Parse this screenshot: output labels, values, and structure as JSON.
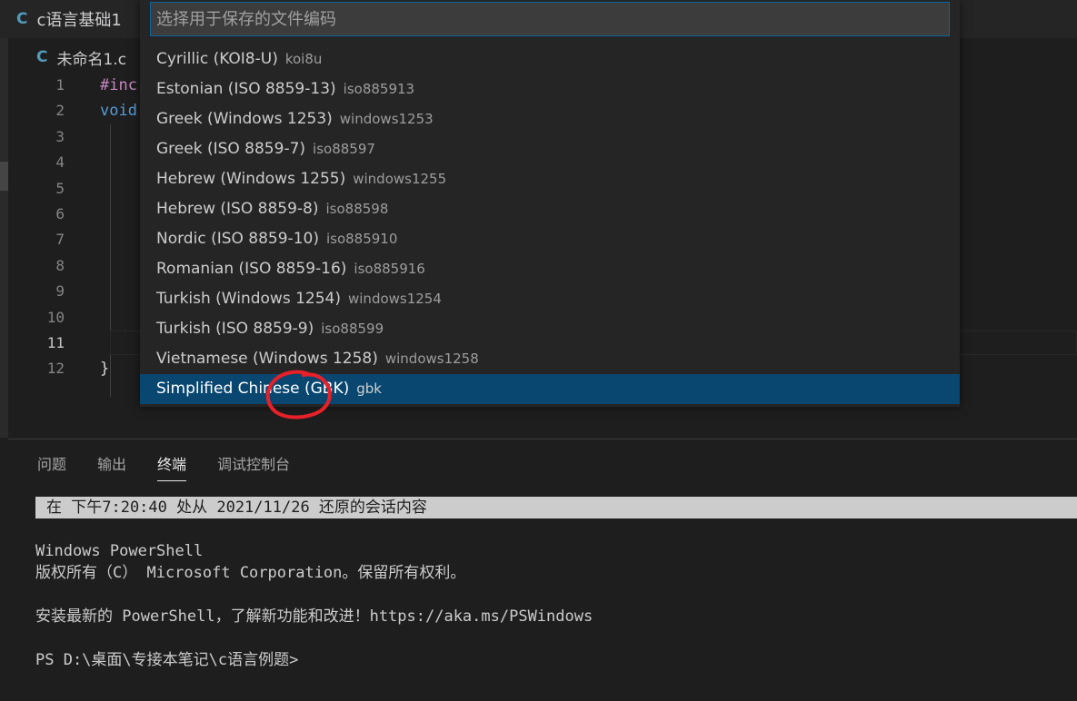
{
  "tab": {
    "label": "c语言基础1"
  },
  "breadcrumb": {
    "file": "未命名1.c"
  },
  "editor": {
    "line_numbers": [
      "1",
      "2",
      "3",
      "4",
      "5",
      "6",
      "7",
      "8",
      "9",
      "10",
      "11",
      "12"
    ],
    "active_line": "11",
    "code": {
      "line1": "#inc",
      "line2": "void",
      "line12": "}"
    }
  },
  "quickpick": {
    "placeholder": "选择用于保存的文件编码",
    "items": [
      {
        "label": "Cyrillic (KOI8-U)",
        "desc": "koi8u"
      },
      {
        "label": "Estonian (ISO 8859-13)",
        "desc": "iso885913"
      },
      {
        "label": "Greek (Windows 1253)",
        "desc": "windows1253"
      },
      {
        "label": "Greek (ISO 8859-7)",
        "desc": "iso88597"
      },
      {
        "label": "Hebrew (Windows 1255)",
        "desc": "windows1255"
      },
      {
        "label": "Hebrew (ISO 8859-8)",
        "desc": "iso88598"
      },
      {
        "label": "Nordic (ISO 8859-10)",
        "desc": "iso885910"
      },
      {
        "label": "Romanian (ISO 8859-16)",
        "desc": "iso885916"
      },
      {
        "label": "Turkish (Windows 1254)",
        "desc": "windows1254"
      },
      {
        "label": "Turkish (ISO 8859-9)",
        "desc": "iso88599"
      },
      {
        "label": "Vietnamese (Windows 1258)",
        "desc": "windows1258"
      },
      {
        "label": "Simplified Chinese (GBK)",
        "desc": "gbk"
      }
    ]
  },
  "panel": {
    "tabs": [
      "问题",
      "输出",
      "终端",
      "调试控制台"
    ],
    "active_tab": "终端"
  },
  "terminal": {
    "banner": "在 下午7:20:40 处从 2021/11/26 还原的会话内容",
    "line1": "Windows PowerShell",
    "line2": "版权所有（C） Microsoft Corporation。保留所有权利。",
    "line3": "安装最新的 PowerShell，了解新功能和改进！https://aka.ms/PSWindows",
    "line4": "PS D:\\桌面\\专接本笔记\\c语言例题>"
  },
  "colors": {
    "selection": "#094771",
    "annotation": "#e8202a",
    "c_icon": "#519aba"
  }
}
